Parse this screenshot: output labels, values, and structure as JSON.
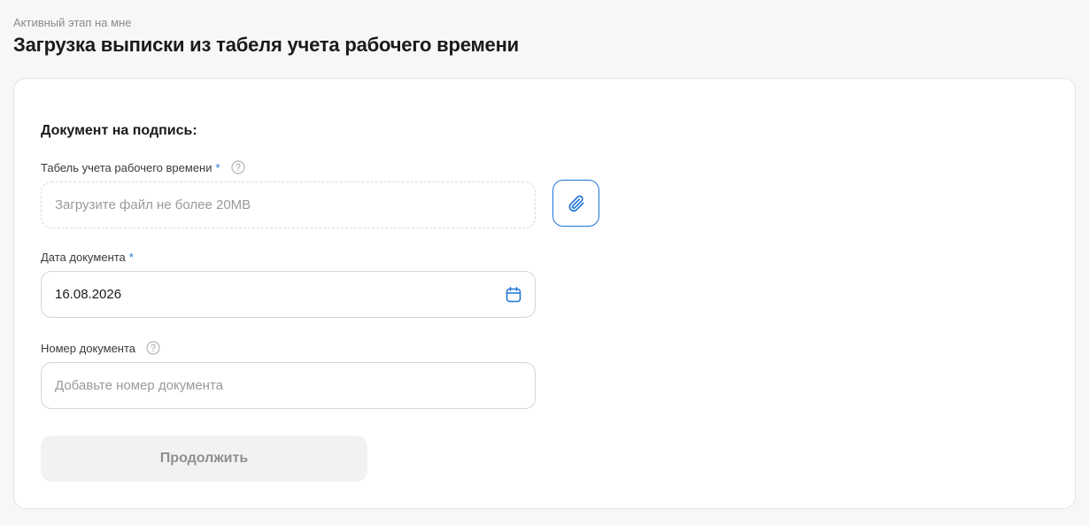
{
  "header": {
    "stage_label": "Активный этап на мне",
    "title": "Загрузка выписки из табеля учета рабочего времени"
  },
  "form": {
    "section_title": "Документ на подпись:",
    "timesheet": {
      "label": "Табель учета рабочего времени",
      "required_mark": "*",
      "placeholder": "Загрузите файл не более 20MB",
      "help_icon": "question-circle-icon",
      "attach_icon": "paperclip-icon"
    },
    "document_date": {
      "label": "Дата документа",
      "required_mark": "*",
      "value": "16.08.2026",
      "icon": "calendar-icon"
    },
    "document_number": {
      "label": "Номер документа",
      "placeholder": "Добавьте номер документа",
      "help_icon": "question-circle-icon"
    },
    "continue_label": "Продолжить"
  },
  "colors": {
    "accent": "#1f74d4",
    "background": "#f7f7f7",
    "card": "#ffffff",
    "disabled_button": "#f2f2f3",
    "disabled_text": "#8f8f8f"
  }
}
